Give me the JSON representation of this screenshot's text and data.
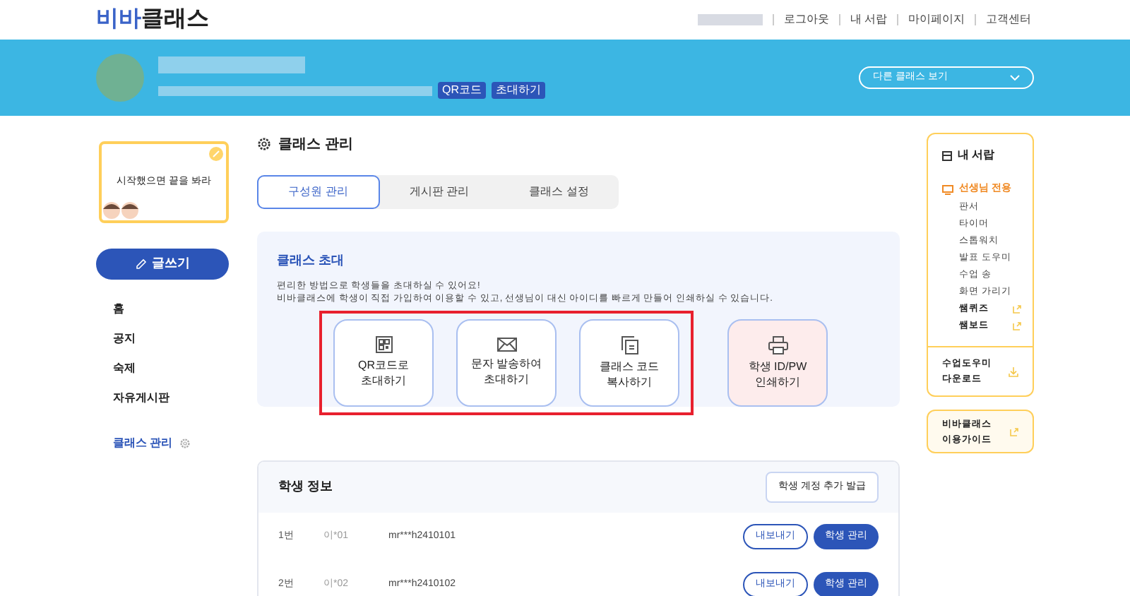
{
  "header": {
    "logo_part1": "비바",
    "logo_part2": "클래스",
    "nav": [
      "로그아웃",
      "내 서랍",
      "마이페이지",
      "고객센터"
    ]
  },
  "class_banner": {
    "buttons": [
      "QR코드",
      "초대하기"
    ],
    "class_select": "다른 클래스 보기"
  },
  "sidebar": {
    "note": "시작했으면 끝을 봐라",
    "write_button": "글쓰기",
    "menu": [
      {
        "label": "홈",
        "selected": false
      },
      {
        "label": "공지",
        "selected": false
      },
      {
        "label": "숙제",
        "selected": false
      },
      {
        "label": "자유게시판",
        "selected": false
      }
    ],
    "manage": {
      "label": "클래스 관리",
      "selected": true
    }
  },
  "page_title": "클래스 관리",
  "tabs": [
    {
      "label": "구성원 관리",
      "selected": true
    },
    {
      "label": "게시판 관리",
      "selected": false
    },
    {
      "label": "클래스 설정",
      "selected": false
    }
  ],
  "invite": {
    "title": "클래스 초대",
    "description": [
      "편리한 방법으로 학생들을 초대하실 수 있어요!",
      "비바클래스에 학생이 직접 가입하여 이용할 수 있고, 선생님이 대신 아이디를 빠르게 만들어 인쇄하실 수 있습니다."
    ],
    "options": [
      {
        "kind": "qr",
        "lines": [
          "QR코드로",
          "초대하기"
        ],
        "highlighted": true
      },
      {
        "kind": "mail",
        "lines": [
          "문자 발송하여",
          "초대하기"
        ],
        "highlighted": true
      },
      {
        "kind": "copy",
        "lines": [
          "클래스 코드",
          "복사하기"
        ],
        "highlighted": true
      },
      {
        "kind": "print",
        "lines": [
          "학생 ID/PW",
          "인쇄하기"
        ],
        "highlighted": false
      }
    ]
  },
  "students": {
    "title": "학생 정보",
    "add_button": "학생 계정 추가 발급",
    "rows": [
      {
        "number": "1번",
        "name": "이*01",
        "account": "mr***h2410101",
        "buttons": [
          "내보내기",
          "학생 관리"
        ]
      },
      {
        "number": "2번",
        "name": "이*02",
        "account": "mr***h2410102",
        "buttons": [
          "내보내기",
          "학생 관리"
        ]
      }
    ]
  },
  "drawer": {
    "title": "내 서랍",
    "items": [
      {
        "kind": "section",
        "label": "선생님 전용"
      },
      {
        "kind": "tool",
        "label": "판서"
      },
      {
        "kind": "tool",
        "label": "타이머"
      },
      {
        "kind": "tool",
        "label": "스톱워치"
      },
      {
        "kind": "tool",
        "label": "발표 도우미"
      },
      {
        "kind": "tool",
        "label": "수업 송"
      },
      {
        "kind": "tool",
        "label": "화면 가리기"
      },
      {
        "kind": "link",
        "label": "쌤퀴즈"
      },
      {
        "kind": "link",
        "label": "쌤보드"
      }
    ],
    "download": [
      "수업도우미",
      "다운로드"
    ]
  },
  "guide": [
    "비바클래스",
    "이용가이드"
  ]
}
